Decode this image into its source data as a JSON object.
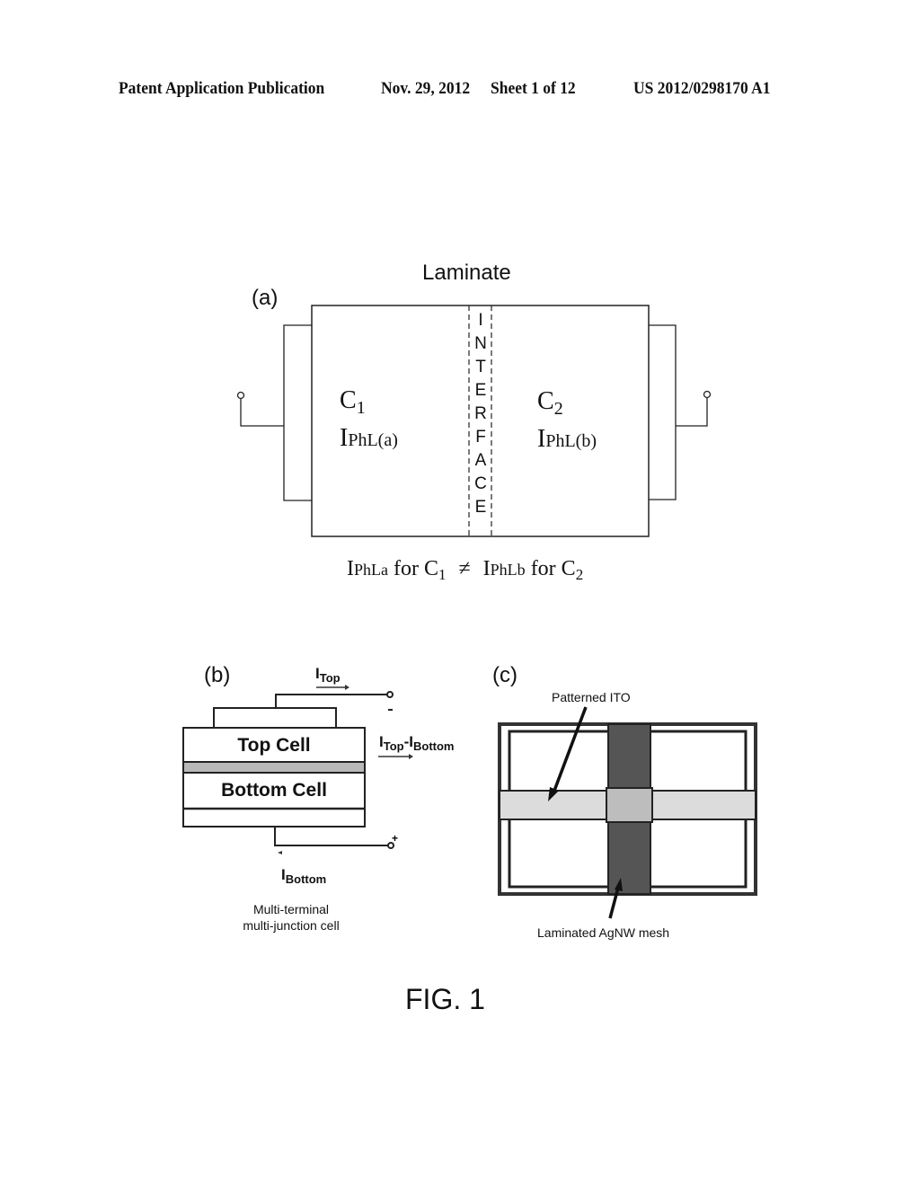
{
  "header": {
    "publication": "Patent Application Publication",
    "date": "Nov. 29, 2012",
    "sheet": "Sheet 1 of 12",
    "patent_number": "US 2012/0298170 A1"
  },
  "figure_a": {
    "panel_label": "(a)",
    "title": "Laminate",
    "interface_letters": [
      "I",
      "N",
      "T",
      "E",
      "R",
      "F",
      "A",
      "C",
      "E"
    ],
    "left_cell": {
      "name": "C",
      "name_sub": "1",
      "current": "I",
      "current_sub": "PhL(a)"
    },
    "right_cell": {
      "name": "C",
      "name_sub": "2",
      "current": "I",
      "current_sub": "PhL(b)"
    },
    "equation": {
      "lhs_i": "I",
      "lhs_sub": "PhLa",
      "lhs_text": " for C",
      "lhs_c_sub": "1",
      "neq": "≠",
      "rhs_i": "I",
      "rhs_sub": "PhLb",
      "rhs_text": " for C",
      "rhs_c_sub": "2"
    }
  },
  "figure_b": {
    "panel_label": "(b)",
    "top_cell": "Top Cell",
    "bottom_cell": "Bottom Cell",
    "i_top": "I",
    "i_top_sub": "Top",
    "i_diff": "I",
    "i_diff_sub1": "Top",
    "i_diff_mid": "-I",
    "i_diff_sub2": "Bottom",
    "i_bottom": "I",
    "i_bottom_sub": "Bottom",
    "caption_line1": "Multi-terminal",
    "caption_line2": "multi-junction cell"
  },
  "figure_c": {
    "panel_label": "(c)",
    "label_top": "Patterned ITO",
    "label_bottom": "Laminated AgNW mesh"
  },
  "figure_caption": "FIG. 1"
}
